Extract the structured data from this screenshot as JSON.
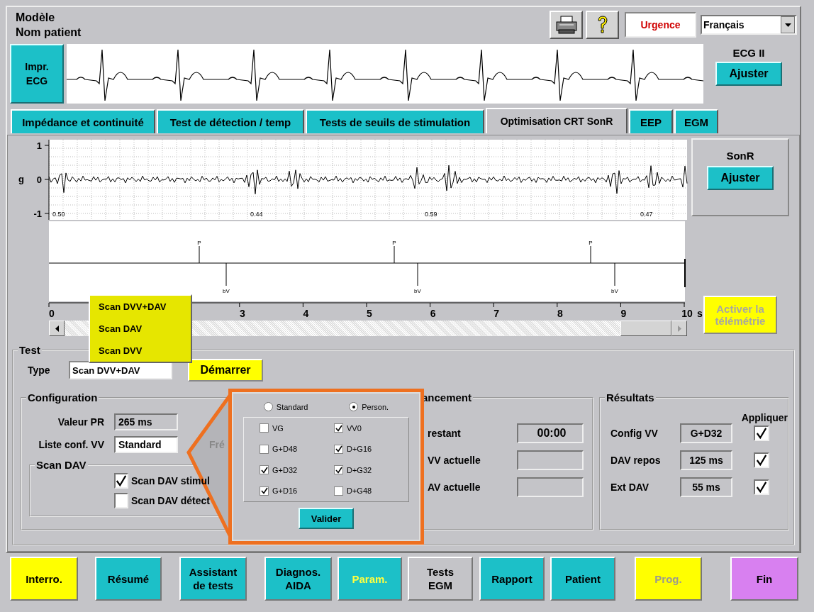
{
  "header": {
    "model": "Modèle",
    "patient": "Nom patient",
    "urgence": "Urgence",
    "language": "Français"
  },
  "ecg": {
    "print_button": "Impr. ECG",
    "lead": "ECG II",
    "adjust_button": "Ajuster"
  },
  "tabs": [
    {
      "label": "Impédance et continuité",
      "selected": false
    },
    {
      "label": "Test de détection / temp",
      "selected": false
    },
    {
      "label": "Tests de seuils de stimulation",
      "selected": false
    },
    {
      "label": "Optimisation CRT SonR",
      "selected": true
    },
    {
      "label": "EEP",
      "selected": false
    },
    {
      "label": "EGM",
      "selected": false
    }
  ],
  "chart": {
    "unit": "g",
    "y_labels": [
      "1",
      "0",
      "-1"
    ],
    "intervals": [
      "0.50",
      "0.44",
      "0.59",
      "0.47"
    ],
    "p_markers": [
      "P",
      "P",
      "P"
    ],
    "v_markers": [
      "bV",
      "bV",
      "bV"
    ],
    "x_labels": [
      "0",
      "3",
      "4",
      "5",
      "6",
      "7",
      "8",
      "9",
      "10"
    ],
    "x_unit": "s"
  },
  "sonr": {
    "title": "SonR",
    "adjust_button": "Ajuster"
  },
  "telemetry_button": {
    "label": "Activer la télémétrie",
    "disabled": true
  },
  "test": {
    "title": "Test",
    "type_label": "Type",
    "type_value": "Scan DVV+DAV",
    "start_button": "Démarrer",
    "dropdown": [
      "Scan DVV+DAV",
      "Scan DAV",
      "Scan DVV"
    ]
  },
  "configuration": {
    "title": "Configuration",
    "pr_label": "Valeur PR",
    "pr_value": "265 ms",
    "vv_label": "Liste conf. VV",
    "vv_value": "Standard",
    "freq_label": "Fré",
    "scan_dav": {
      "title": "Scan DAV",
      "options": [
        {
          "label": "Scan DAV stimul",
          "checked": true
        },
        {
          "label": "Scan DAV détect",
          "checked": false
        }
      ]
    }
  },
  "callout": {
    "radios": [
      {
        "label": "Standard",
        "selected": false
      },
      {
        "label": "Person.",
        "selected": true
      }
    ],
    "configs": [
      {
        "label": "VG",
        "checked": false
      },
      {
        "label": "VV0",
        "checked": true
      },
      {
        "label": "G+D48",
        "checked": false
      },
      {
        "label": "D+G16",
        "checked": true
      },
      {
        "label": "G+D32",
        "checked": true
      },
      {
        "label": "D+G32",
        "checked": true
      },
      {
        "label": "G+D16",
        "checked": true
      },
      {
        "label": "D+G48",
        "checked": false
      }
    ],
    "validate_button": "Valider"
  },
  "progress": {
    "title": "ancement",
    "rows": [
      {
        "label": "restant",
        "value": "00:00"
      },
      {
        "label": "VV actuelle"
      },
      {
        "label": "AV actuelle"
      }
    ]
  },
  "results": {
    "title": "Résultats",
    "apply_header": "Appliquer",
    "rows": [
      {
        "label": "Config VV",
        "value": "G+D32",
        "checked": true
      },
      {
        "label": "DAV repos",
        "value": "125 ms",
        "checked": true
      },
      {
        "label": "Ext DAV",
        "value": "55 ms",
        "checked": true
      }
    ]
  },
  "bottom_buttons": [
    {
      "label": "Interro.",
      "color": "#ffff00",
      "active": false,
      "disabled": false
    },
    {
      "label": "Résumé",
      "color": "#1cc0c8",
      "active": false,
      "disabled": false
    },
    {
      "label": "Assistant de tests",
      "color": "#1cc0c8",
      "active": false,
      "disabled": false
    },
    {
      "label": "Diagnos. AIDA",
      "color": "#1cc0c8",
      "active": false,
      "disabled": false
    },
    {
      "label": "Param.",
      "color": "#1cc0c8",
      "active": true,
      "disabled": false
    },
    {
      "label": "Tests EGM",
      "color": "#c4c4c8",
      "active": false,
      "disabled": false
    },
    {
      "label": "Rapport",
      "color": "#1cc0c8",
      "active": false,
      "disabled": false
    },
    {
      "label": "Patient",
      "color": "#1cc0c8",
      "active": false,
      "disabled": false
    },
    {
      "label": "Prog.",
      "color": "#ffff00",
      "active": false,
      "disabled": true
    },
    {
      "label": "Fin",
      "color": "#d880f0",
      "active": false,
      "disabled": false
    }
  ]
}
